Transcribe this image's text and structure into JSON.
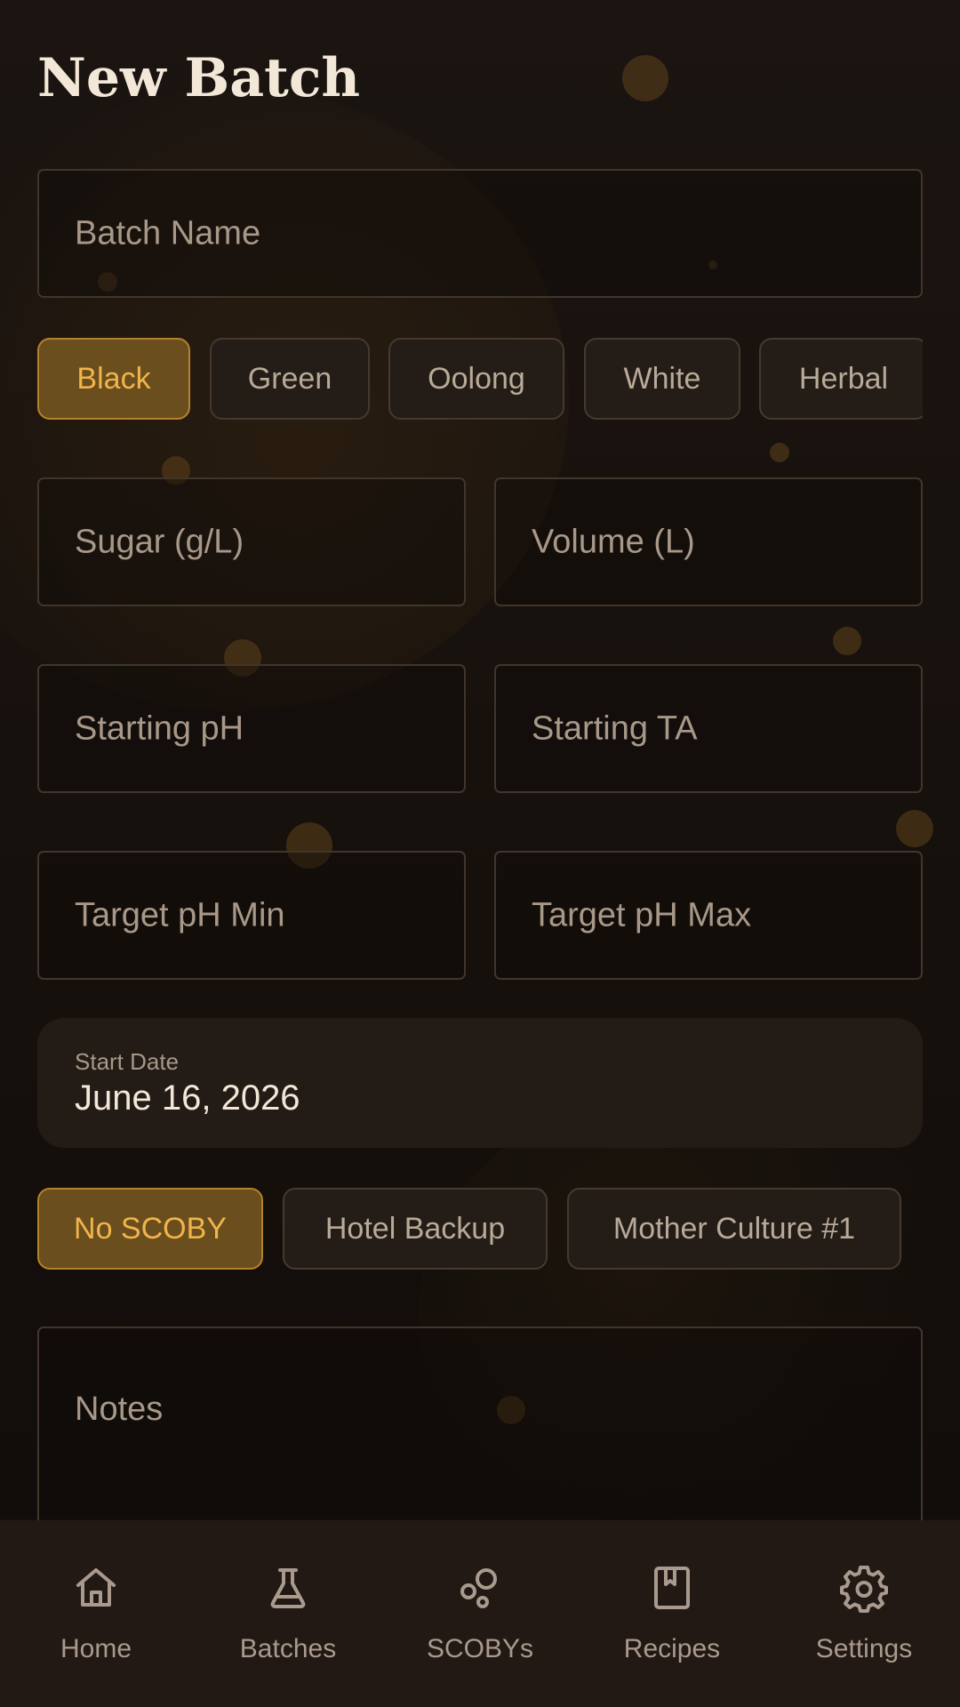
{
  "page": {
    "title": "New Batch"
  },
  "form": {
    "batch_name": {
      "placeholder": "Batch Name"
    },
    "tea_types": [
      {
        "label": "Black",
        "selected": true
      },
      {
        "label": "Green",
        "selected": false
      },
      {
        "label": "Oolong",
        "selected": false
      },
      {
        "label": "White",
        "selected": false
      },
      {
        "label": "Herbal",
        "selected": false
      }
    ],
    "sugar": {
      "placeholder": "Sugar (g/L)"
    },
    "volume": {
      "placeholder": "Volume (L)"
    },
    "starting_ph": {
      "placeholder": "Starting pH"
    },
    "starting_ta": {
      "placeholder": "Starting TA"
    },
    "target_ph_min": {
      "placeholder": "Target pH Min"
    },
    "target_ph_max": {
      "placeholder": "Target pH Max"
    },
    "start_date": {
      "label": "Start Date",
      "value": "June 16, 2026"
    },
    "scoby_options": [
      {
        "label": "No SCOBY",
        "selected": true
      },
      {
        "label": "Hotel Backup",
        "selected": false
      },
      {
        "label": "Mother Culture #1",
        "selected": false
      }
    ],
    "notes": {
      "placeholder": "Notes"
    }
  },
  "nav": {
    "items": [
      {
        "label": "Home",
        "icon": "home-icon"
      },
      {
        "label": "Batches",
        "icon": "flask-icon"
      },
      {
        "label": "SCOBYs",
        "icon": "scoby-icon"
      },
      {
        "label": "Recipes",
        "icon": "book-icon"
      },
      {
        "label": "Settings",
        "icon": "gear-icon"
      }
    ]
  },
  "colors": {
    "background": "#1b1410",
    "accent": "#f1b44c",
    "accent_fill": "#6a4e1d",
    "accent_border": "#b3822d",
    "surface": "#231c17",
    "field_border": "#41352b",
    "text_primary": "#f3e7d8",
    "text_secondary": "#a89888"
  }
}
